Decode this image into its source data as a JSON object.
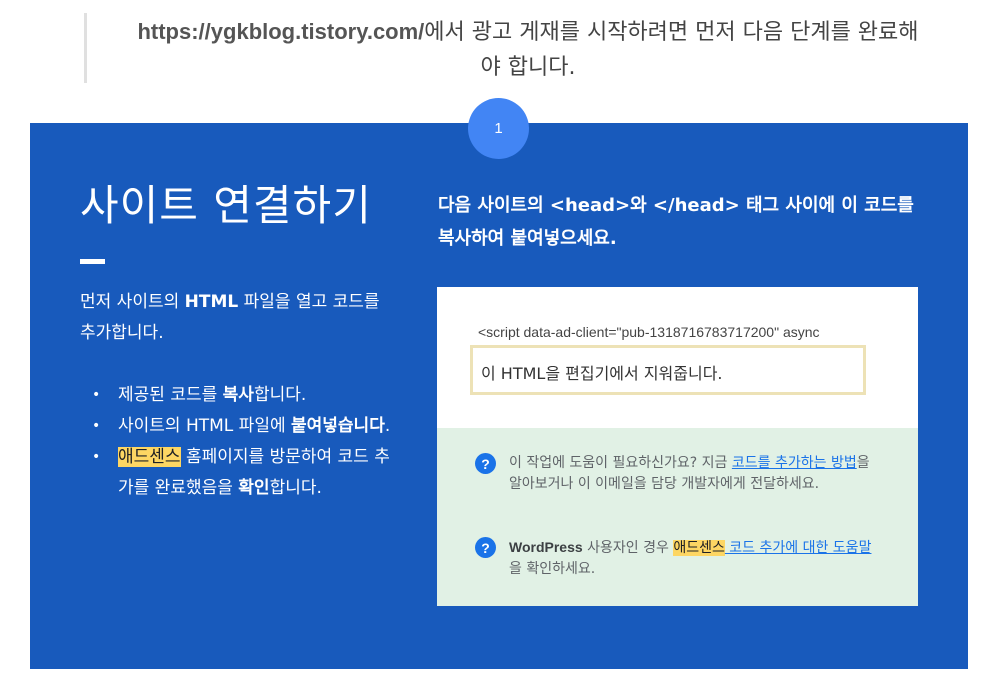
{
  "intro": {
    "url": "https://ygkblog.tistory.com/",
    "text": "에서 광고 게재를 시작하려면 먼저 다음 단계를 완료해야 합니다."
  },
  "step": {
    "number": "1"
  },
  "panel": {
    "title": "사이트 연결하기",
    "desc_prefix": "먼저 사이트의 ",
    "desc_html": "HTML",
    "desc_suffix": " 파일을 열고 코드를 추가합니다.",
    "bullets": [
      {
        "pre": "제공된 코드를 ",
        "bold": "복사",
        "post": "합니다."
      },
      {
        "pre": "사이트의 HTML 파일에 ",
        "bold": "붙여넣습니다",
        "post": "."
      },
      {
        "highlight": "애드센스",
        "pre": " 홈페이지를 방문하여 코드 추가를 완료했음을 ",
        "bold": "확인",
        "post": "합니다."
      }
    ],
    "instruction": "다음 사이트의 <head>와 </head> 태그 사이에 이 코드를 복사하여 붙여넣으세요."
  },
  "code": {
    "snippet": "<script data-ad-client=\"pub-1318716783717200\" async",
    "warning": "이 HTML을 편집기에서 지워줍니다."
  },
  "help": {
    "item1": {
      "pre": "이 작업에 도움이 필요하신가요? 지금 ",
      "link": "코드를 추가하는 방법",
      "post": "을 알아보거나 이 이메일을 담당 개발자에게 전달하세요."
    },
    "item2": {
      "brand": "WordPress",
      "pre": " 사용자인 경우 ",
      "highlight": "애드센스",
      "link": " 코드 추가에 대한 도움말",
      "post": "을 확인하세요."
    },
    "icon": "help-circle-icon"
  },
  "colors": {
    "panel": "#185abc",
    "step_circle": "#4285f4",
    "help_bg": "#e1f1e5",
    "highlight": "#fdd663",
    "link": "#1a73e8"
  }
}
